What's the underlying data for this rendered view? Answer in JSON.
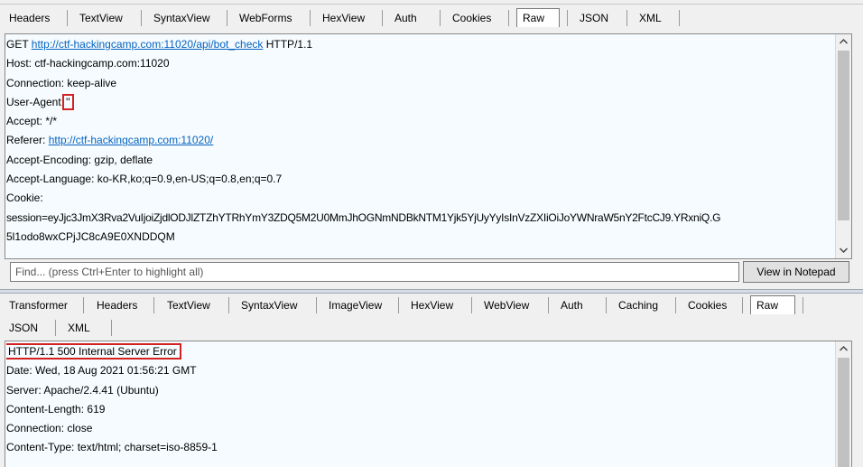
{
  "request": {
    "tabs": [
      {
        "label": "Headers"
      },
      {
        "label": "TextView"
      },
      {
        "label": "SyntaxView"
      },
      {
        "label": "WebForms"
      },
      {
        "label": "HexView"
      },
      {
        "label": "Auth"
      },
      {
        "label": "Cookies"
      },
      {
        "label": "Raw",
        "selected": true
      },
      {
        "label": "JSON"
      },
      {
        "label": "XML"
      }
    ],
    "raw": {
      "method": "GET",
      "url": "http://ctf-hackingcamp.com:11020/api/bot_check",
      "protocol": "HTTP/1.1",
      "host": "Host: ctf-hackingcamp.com:11020",
      "connection": "Connection: keep-alive",
      "user_agent_name": "User-Agent:",
      "user_agent_value": "''",
      "accept": "Accept: */*",
      "referer_name": "Referer:",
      "referer_url": "http://ctf-hackingcamp.com:11020/",
      "accept_encoding": "Accept-Encoding: gzip, deflate",
      "accept_language": "Accept-Language: ko-KR,ko;q=0.9,en-US;q=0.8,en;q=0.7",
      "cookie": "Cookie:",
      "session_line1": "session=eyJjc3JmX3Rva2VuIjoiZjdlODJlZTZhYTRhYmY3ZDQ5M2U0MmJhOGNmNDBkNTM1Yjk5YjUyYyIsInVzZXIiOiJoYWNraW5nY2FtcCJ9.YRxniQ.G",
      "session_line2": "5l1odo8wxCPjJC8cA9E0XNDDQM"
    },
    "find": {
      "placeholder": "Find... (press Ctrl+Enter to highlight all)",
      "button_label": "View in Notepad"
    }
  },
  "response": {
    "tabs": [
      {
        "label": "Transformer"
      },
      {
        "label": "Headers"
      },
      {
        "label": "TextView"
      },
      {
        "label": "SyntaxView"
      },
      {
        "label": "ImageView"
      },
      {
        "label": "HexView"
      },
      {
        "label": "WebView"
      },
      {
        "label": "Auth"
      },
      {
        "label": "Caching"
      },
      {
        "label": "Cookies"
      },
      {
        "label": "Raw",
        "selected": true
      }
    ],
    "tabs_row2": [
      {
        "label": "JSON"
      },
      {
        "label": "XML"
      }
    ],
    "raw": {
      "status": "HTTP/1.1 500 Internal Server Error",
      "date": "Date: Wed, 18 Aug 2021 01:56:21 GMT",
      "server": "Server: Apache/2.4.41 (Ubuntu)",
      "content_length": "Content-Length: 619",
      "connection": "Connection: close",
      "content_type": "Content-Type: text/html; charset=iso-8859-1"
    }
  },
  "icons": {
    "scroll_up": "chevron-up-icon",
    "scroll_down": "chevron-down-icon"
  },
  "colors": {
    "pane_background": "#f5fbfe",
    "link": "#0563c1",
    "highlight_box": "#d42020"
  }
}
